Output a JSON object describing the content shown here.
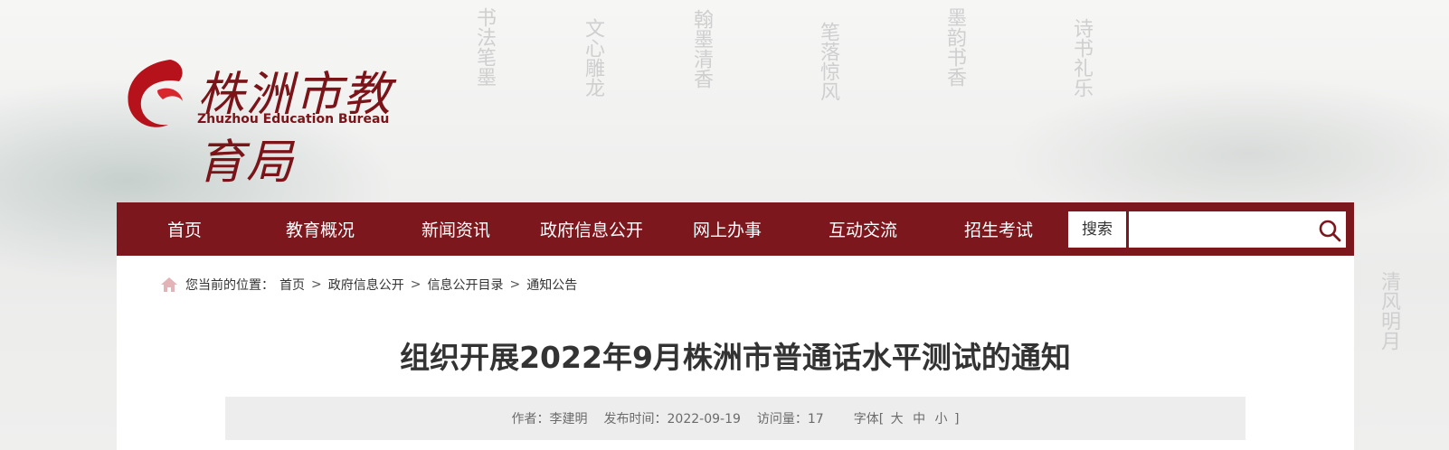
{
  "header": {
    "logo_cn": "株洲市教育局",
    "logo_en": "Zhuzhou Education Bureau"
  },
  "nav": {
    "items": [
      "首页",
      "教育概况",
      "新闻资讯",
      "政府信息公开",
      "网上办事",
      "互动交流",
      "招生考试"
    ],
    "search_label": "搜索",
    "search_value": ""
  },
  "breadcrumb": {
    "prefix": "您当前的位置：",
    "items": [
      "首页",
      "政府信息公开",
      "信息公开目录",
      "通知公告"
    ],
    "separator": ">"
  },
  "article": {
    "title": "组织开展2022年9月株洲市普通话水平测试的通知",
    "author_label": "作者：",
    "author": "李建明",
    "date_label": "发布时间：",
    "date": "2022-09-19",
    "views_label": "访问量：",
    "views": "17",
    "font_label": "字体[",
    "font_large": "大",
    "font_medium": "中",
    "font_small": "小",
    "font_close": "]"
  },
  "colors": {
    "nav_bg": "#7c171d",
    "brand_red": "#7a1419"
  },
  "icons": {
    "home": "home-icon",
    "search": "search-icon",
    "logo": "flame-logo-icon"
  }
}
